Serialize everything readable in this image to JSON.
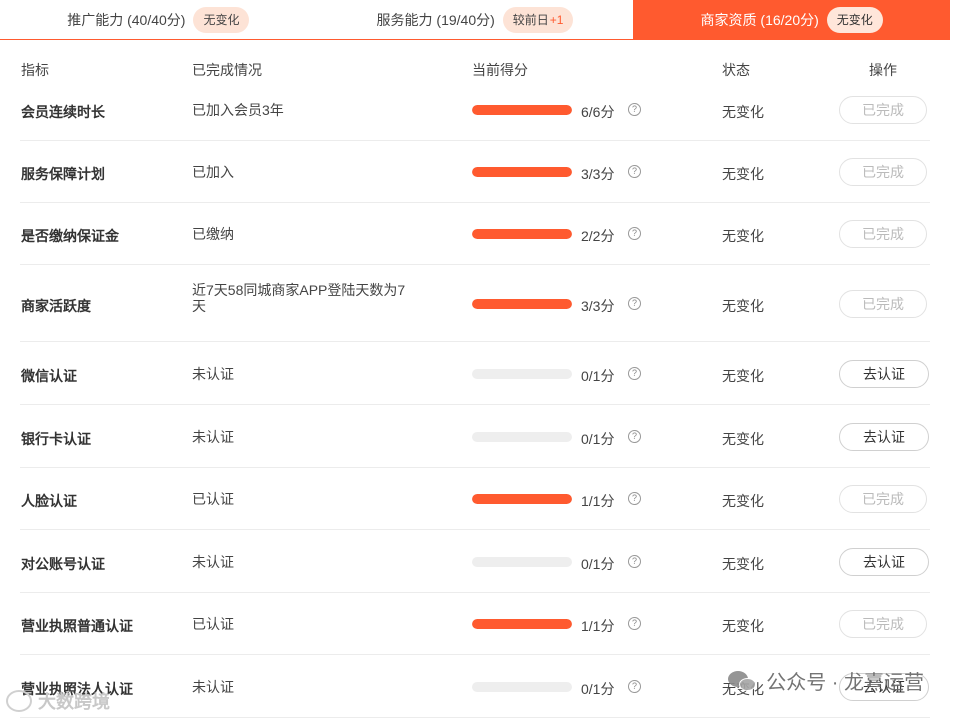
{
  "tabs": [
    {
      "label": "推广能力 (40/40分)",
      "badge": "无变化",
      "delta": "",
      "active": false
    },
    {
      "label": "服务能力 (19/40分)",
      "badge": "较前日",
      "delta": "+1",
      "active": false
    },
    {
      "label": "商家资质 (16/20分)",
      "badge": "无变化",
      "delta": "",
      "active": true
    }
  ],
  "columns": {
    "indicator": "指标",
    "completion": "已完成情况",
    "score": "当前得分",
    "status": "状态",
    "action": "操作"
  },
  "rows": [
    {
      "name": "会员连续时长",
      "completion": "已加入会员3年",
      "score_text": "6/6分",
      "progress": 1.0,
      "status": "无变化",
      "action": "已完成",
      "action_enabled": false
    },
    {
      "name": "服务保障计划",
      "completion": "已加入",
      "score_text": "3/3分",
      "progress": 1.0,
      "status": "无变化",
      "action": "已完成",
      "action_enabled": false
    },
    {
      "name": "是否缴纳保证金",
      "completion": "已缴纳",
      "score_text": "2/2分",
      "progress": 1.0,
      "status": "无变化",
      "action": "已完成",
      "action_enabled": false
    },
    {
      "name": "商家活跃度",
      "completion": "近7天58同城商家APP登陆天数为7天",
      "score_text": "3/3分",
      "progress": 1.0,
      "status": "无变化",
      "action": "已完成",
      "action_enabled": false
    },
    {
      "name": "微信认证",
      "completion": "未认证",
      "score_text": "0/1分",
      "progress": 0.0,
      "status": "无变化",
      "action": "去认证",
      "action_enabled": true
    },
    {
      "name": "银行卡认证",
      "completion": "未认证",
      "score_text": "0/1分",
      "progress": 0.0,
      "status": "无变化",
      "action": "去认证",
      "action_enabled": true
    },
    {
      "name": "人脸认证",
      "completion": "已认证",
      "score_text": "1/1分",
      "progress": 1.0,
      "status": "无变化",
      "action": "已完成",
      "action_enabled": false
    },
    {
      "name": "对公账号认证",
      "completion": "未认证",
      "score_text": "0/1分",
      "progress": 0.0,
      "status": "无变化",
      "action": "去认证",
      "action_enabled": true
    },
    {
      "name": "营业执照普通认证",
      "completion": "已认证",
      "score_text": "1/1分",
      "progress": 1.0,
      "status": "无变化",
      "action": "已完成",
      "action_enabled": false
    },
    {
      "name": "营业执照法人认证",
      "completion": "未认证",
      "score_text": "0/1分",
      "progress": 0.0,
      "status": "无变化",
      "action": "去认证",
      "action_enabled": true
    }
  ],
  "help_glyph": "?",
  "watermark": {
    "text": "公众号 · 龙熹运营",
    "secondary": "大数跨境"
  },
  "colors": {
    "accent": "#ff5a2f",
    "track": "#eeeeee",
    "badge_bg": "#fde3d6"
  }
}
